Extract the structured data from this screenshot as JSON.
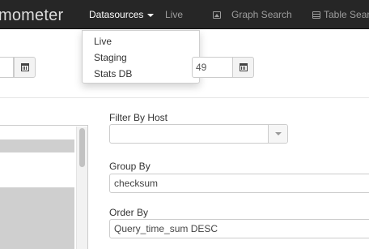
{
  "navbar": {
    "brand": "mometer",
    "datasources_label": "Datasources",
    "live_label": "Live",
    "graph_search_label": "Graph Search",
    "table_search_label": "Table Sear"
  },
  "dropdown": {
    "items": [
      "Live",
      "Staging",
      "Stats DB"
    ]
  },
  "date_range": {
    "start_value": "",
    "end_value": "49"
  },
  "form": {
    "filter_by_host_label": "Filter By Host",
    "filter_by_host_value": "",
    "group_by_label": "Group By",
    "group_by_value": "checksum",
    "order_by_label": "Order By",
    "order_by_value": "Query_time_sum DESC"
  }
}
